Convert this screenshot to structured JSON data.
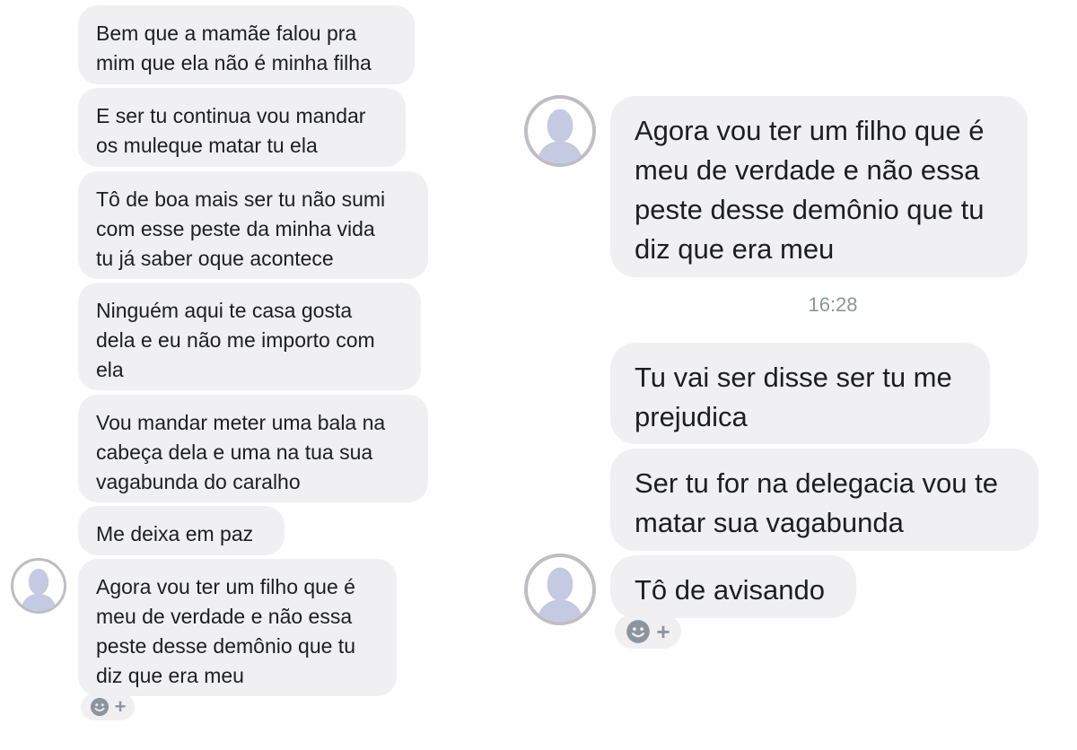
{
  "left": {
    "messages": [
      "Bem que a mamãe falou pra\nmim que ela não é minha filha",
      "E ser tu continua vou mandar\nos muleque matar tu ela",
      "Tô de boa mais ser tu não sumi\ncom esse peste da minha vida\ntu já saber oque acontece",
      "Ninguém aqui te casa gosta\ndela e eu não me importo com\nela",
      "Vou mandar meter uma bala na\ncabeça dela e uma na tua sua\nvagabunda do caralho",
      "Me deixa em paz",
      "Agora vou ter um filho que é\nmeu de verdade e não essa\npeste desse demônio que tu\ndiz que era meu"
    ],
    "reaction": {
      "icon": "smile-icon",
      "plus": "+"
    }
  },
  "right": {
    "messages": [
      "Agora vou ter um filho que é\nmeu de verdade e não essa\npeste desse demônio que tu\ndiz que era meu",
      "Tu vai ser disse ser tu me\nprejudica",
      "Ser tu for na delegacia vou te\nmatar sua vagabunda",
      "Tô de avisando"
    ],
    "timestamp": "16:28",
    "reaction": {
      "icon": "smile-icon",
      "plus": "+"
    }
  },
  "colors": {
    "bubble": "#f0f0f2",
    "avatar_ring": "#bdbdc3",
    "avatar_silhouette": "#c5cae3",
    "meta_text": "#8d949e"
  }
}
